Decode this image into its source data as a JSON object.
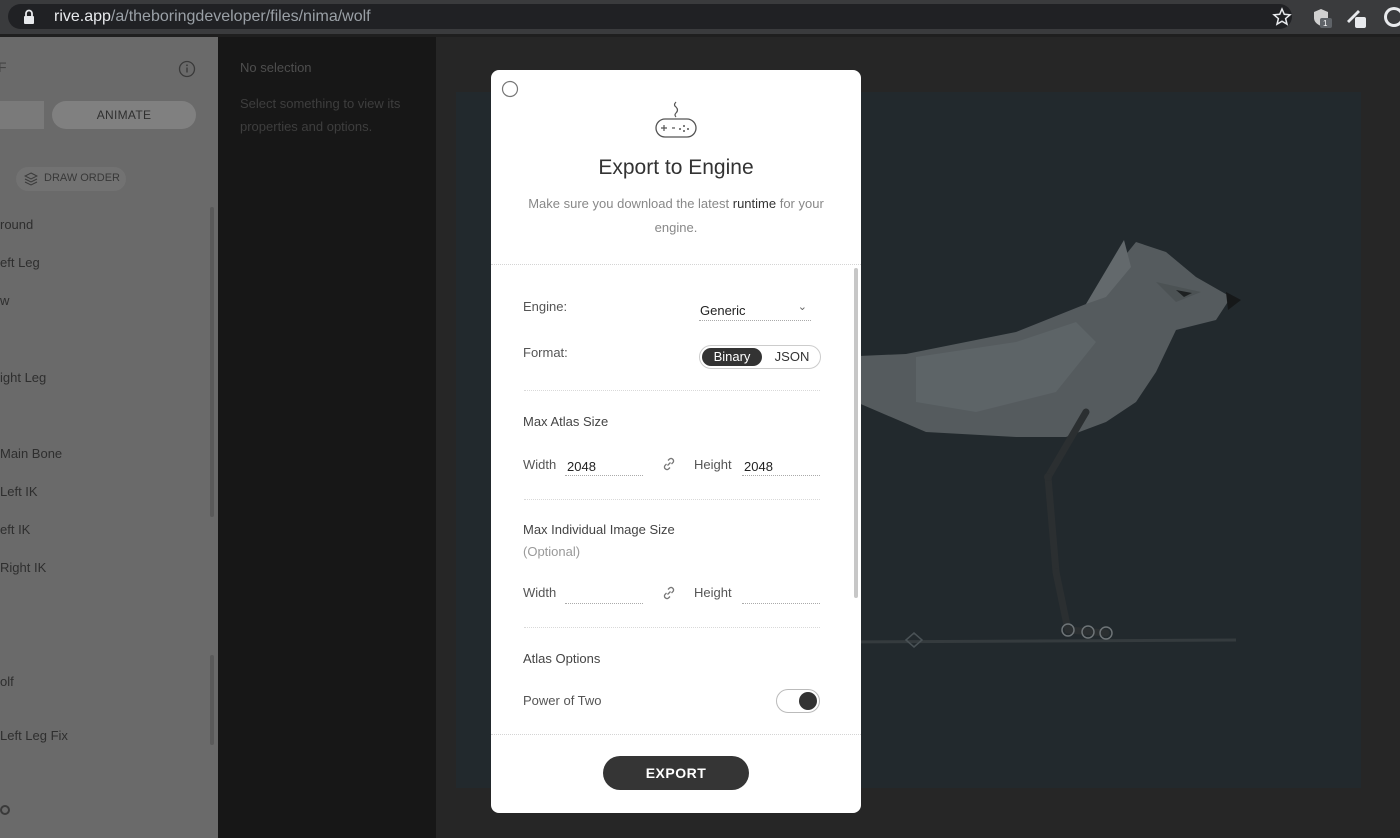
{
  "browser": {
    "url_host": "rive.app",
    "url_path": "/a/theboringdeveloper/files/nima/wolf",
    "extension_badge": "1"
  },
  "left_panel": {
    "mode_tab": "ANIMATE",
    "draw_order": "DRAW ORDER",
    "hierarchy": [
      "round",
      "eft Leg",
      "w",
      "ight Leg",
      "Main Bone",
      "Left IK",
      "eft IK",
      "Right IK",
      "olf",
      " Left Leg Fix"
    ]
  },
  "inspector": {
    "title": "No selection",
    "hint": "Select something to view its properties and options."
  },
  "modal": {
    "title": "Export to Engine",
    "subtitle_before": "Make sure you download the latest ",
    "subtitle_link": "runtime",
    "subtitle_after": " for your engine.",
    "engine_label": "Engine:",
    "engine_value": "Generic",
    "format_label": "Format:",
    "format_options": [
      "Binary",
      "JSON"
    ],
    "format_selected": "Binary",
    "atlas_title": "Max Atlas Size",
    "atlas_width_label": "Width",
    "atlas_width_value": "2048",
    "atlas_height_label": "Height",
    "atlas_height_value": "2048",
    "image_title": "Max Individual Image Size",
    "image_optional": "(Optional)",
    "image_width_label": "Width",
    "image_width_value": "",
    "image_height_label": "Height",
    "image_height_value": "",
    "atlas_options_title": "Atlas Options",
    "power_of_two_label": "Power of Two",
    "power_of_two_on": true,
    "export_label": "EXPORT"
  },
  "colors": {
    "accent_dark": "#353535",
    "artboard": "#22292d",
    "overlay_panel": "#6a6a6a"
  }
}
